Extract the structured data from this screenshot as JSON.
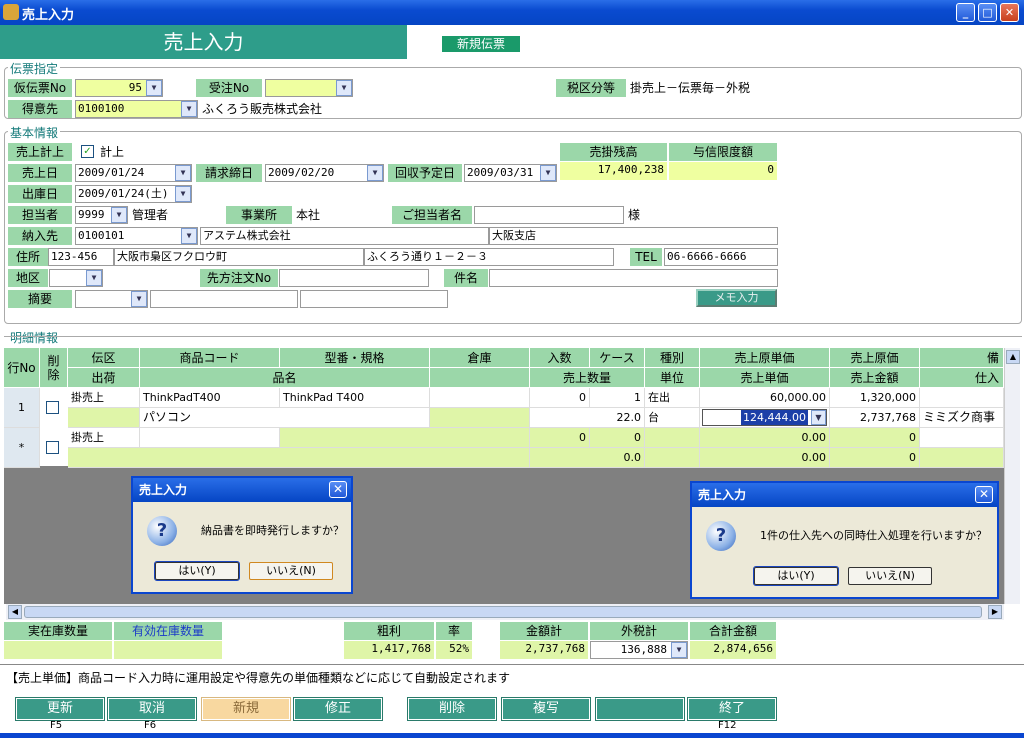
{
  "window": {
    "title": "売上入力",
    "min": "_",
    "max": "□",
    "close": "✕"
  },
  "header": {
    "title": "売上入力",
    "new_slip": "新規伝票"
  },
  "slip": {
    "legend": "伝票指定",
    "temp_no_label": "仮伝票No",
    "temp_no": "95",
    "order_no_label": "受注No",
    "order_no": "",
    "tax_label": "税区分等",
    "tax_value": "掛売上－伝票毎－外税",
    "customer_label": "得意先",
    "customer_code": "0100100",
    "customer_name": "ふくろう販売株式会社"
  },
  "basic": {
    "legend": "基本情報",
    "sales_post_label": "売上計上",
    "sales_post_check": "✓",
    "sales_post_text": "計上",
    "ar_balance_label": "売掛残高",
    "ar_balance": "17,400,238",
    "credit_label": "与信限度額",
    "credit": "0",
    "sales_date_label": "売上日",
    "sales_date": "2009/01/24",
    "close_date_label": "請求締日",
    "close_date": "2009/02/20",
    "collect_label": "回収予定日",
    "collect_date": "2009/03/31",
    "ship_date_label": "出庫日",
    "ship_date": "2009/01/24(土)",
    "staff_label": "担当者",
    "staff_code": "9999",
    "staff_name": "管理者",
    "office_label": "事業所",
    "office": "本社",
    "contact_label": "ご担当者名",
    "contact": "",
    "contact_suffix": "様",
    "dest_label": "納入先",
    "dest_code": "0100101",
    "dest_name": "アステム株式会社",
    "dest_branch": "大阪支店",
    "addr_label": "住所",
    "zip": "123-456",
    "addr1": "大阪市梟区フクロウ町",
    "addr2": "ふくろう通り１－２－３",
    "tel_label": "TEL",
    "tel": "06-6666-6666",
    "area_label": "地区",
    "area": "",
    "order_ref_label": "先方注文No",
    "order_ref": "",
    "subject_label": "件名",
    "subject": "",
    "memo_label": "摘要",
    "memo_btn": "メモ入力"
  },
  "detail": {
    "legend": "明細情報",
    "h1": [
      "行No",
      "削除",
      "伝区",
      "商品コード",
      "型番・規格",
      "倉庫",
      "入数",
      "ケース",
      "種別",
      "売上原単価",
      "売上原価",
      "備"
    ],
    "h2": [
      "出荷",
      "品名",
      "売上数量",
      "単位",
      "売上単価",
      "売上金額",
      "仕入"
    ],
    "row1": {
      "no": "1",
      "kind": "掛売上",
      "code": "ThinkPadT400",
      "model": "ThinkPad T400",
      "warehouse": "",
      "irisu": "0",
      "case": "1",
      "type": "在出",
      "cost_unit": "60,000.00",
      "cost": "1,320,000",
      "name": "パソコン",
      "qty": "22.0",
      "unit": "台",
      "price": "124,444.00",
      "amount": "2,737,768",
      "supplier": "ミミズク商事"
    },
    "row2": {
      "no": "*",
      "kind": "掛売上",
      "irisu": "0",
      "case": "0",
      "cost_unit": "0.00",
      "cost": "0",
      "qty": "0.0",
      "price": "0.00",
      "amount": "0"
    }
  },
  "dialog1": {
    "title": "売上入力",
    "message": "納品書を即時発行しますか？",
    "yes": "はい(Y)",
    "no": "いいえ(N)"
  },
  "dialog2": {
    "title": "売上入力",
    "message": "1件の仕入先への同時仕入処理を行いますか？",
    "yes": "はい(Y)",
    "no": "いいえ(N)"
  },
  "summary": {
    "stock_label": "実在庫数量",
    "eff_stock_label": "有効在庫数量",
    "gross_label": "粗利",
    "gross": "1,417,768",
    "rate_label": "率",
    "rate": "52%",
    "total_label": "金額計",
    "total": "2,737,768",
    "tax_label": "外税計",
    "tax": "136,888",
    "grand_label": "合計金額",
    "grand": "2,874,656"
  },
  "hint": "【売上単価】商品コード入力時に運用設定や得意先の単価種類などに応じて自動設定されます",
  "buttons": [
    {
      "label": "更新",
      "key": "F5"
    },
    {
      "label": "取消",
      "key": "F6"
    },
    {
      "label": "新規",
      "key": ""
    },
    {
      "label": "修正",
      "key": ""
    },
    {
      "label": "削除",
      "key": ""
    },
    {
      "label": "複写",
      "key": ""
    },
    {
      "label": "",
      "key": ""
    },
    {
      "label": "終了",
      "key": "F12"
    }
  ]
}
